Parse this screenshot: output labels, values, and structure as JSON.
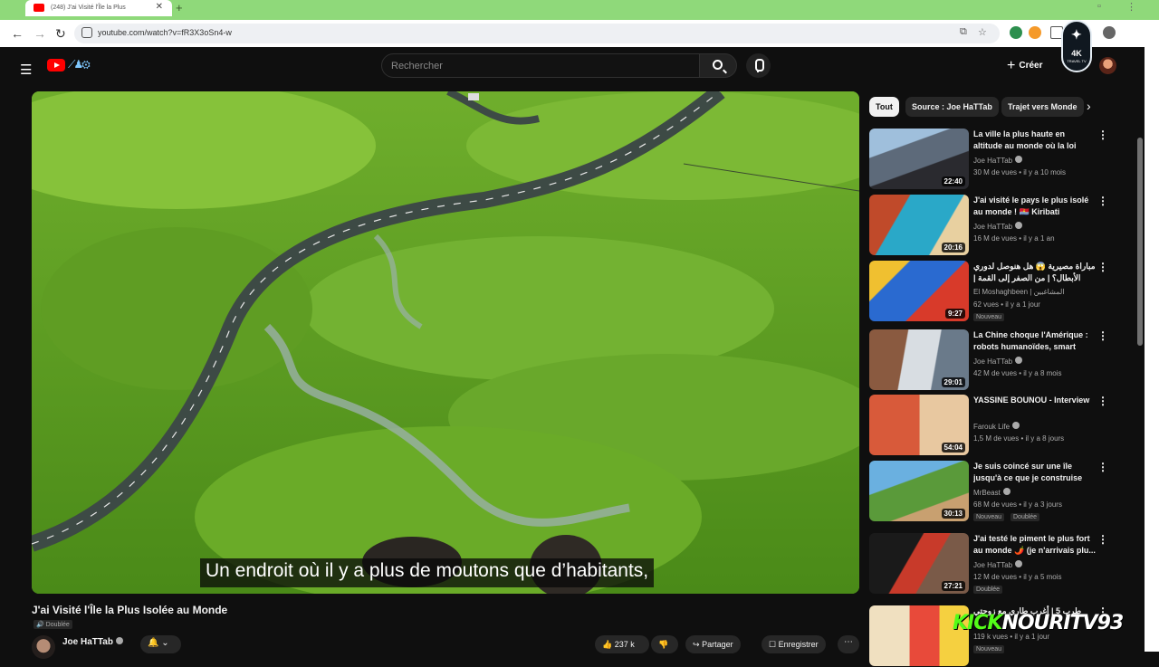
{
  "browser": {
    "tab_title": "(248) J'ai Visité l'Île la Plus",
    "url": "youtube.com/watch?v=fR3X3oSn4-w",
    "nav": {
      "back": "←",
      "forward": "→",
      "reload": "↻"
    }
  },
  "badge": {
    "label": "4K",
    "sub": "TRAVEL TV"
  },
  "youtube": {
    "search_placeholder": "Rechercher",
    "create_label": "Créer"
  },
  "video": {
    "subtitle": "Un endroit où il y a plus de moutons que d’habitants,",
    "title": "J'ai Visité l'Île la Plus Isolée au Monde",
    "dubbed": "Doublée",
    "channel": "Joe HaTTab",
    "likes": "237 k",
    "share_label": "Partager",
    "save_label": "Enregistrer"
  },
  "chips": [
    "Tout",
    "Source : Joe HaTTab",
    "Trajet vers Monde"
  ],
  "recommendations": [
    {
      "title": "La ville la plus haute en altitude au monde où la loi n'existe pas...",
      "channel": "Joe HaTTab",
      "meta": "30 M de vues • il y a 10 mois",
      "duration": "22:40",
      "badges": []
    },
    {
      "title": "J'ai visité le pays le plus isolé au monde ! 🇰🇮 Kiribati",
      "channel": "Joe HaTTab",
      "meta": "16 M de vues • il y a 1 an",
      "duration": "20:16",
      "badges": []
    },
    {
      "title": "مباراة مصيرية 😱 هل هنوصل لدوري الأبطال؟ | من الصفر إلى القمة | الحلقة",
      "channel": "El Moshaghbeen | المشاغبين",
      "meta": "62 vues • il y a 1 jour",
      "duration": "9:27",
      "badges": [
        "Nouveau"
      ]
    },
    {
      "title": "La Chine choque l'Amérique : robots humanoïdes, smart citi...",
      "channel": "Joe HaTTab",
      "meta": "42 M de vues • il y a 8 mois",
      "duration": "29:01",
      "badges": []
    },
    {
      "title": "YASSINE BOUNOU - Interview",
      "channel": "Farouk Life",
      "meta": "1,5 M de vues • il y a 8 jours",
      "duration": "54:04",
      "badges": []
    },
    {
      "title": "Je suis coincé sur une île jusqu'à ce que je construise un...",
      "channel": "MrBeast",
      "meta": "68 M de vues • il y a 3 jours",
      "duration": "30:13",
      "badges": [
        "Nouveau",
        "Doublée"
      ]
    },
    {
      "title": "J'ai testé le piment le plus fort au monde 🌶️ (je n'arrivais plu...",
      "channel": "Joe HaTTab",
      "meta": "12 M de vues • il y a 5 mois",
      "duration": "27:21",
      "badges": [
        "Doublée"
      ]
    },
    {
      "title": "طرب 5 | أغرب طاري مع زوجتي",
      "channel": "",
      "meta": "119 k vues • il y a 1 jour",
      "duration": "",
      "badges": [
        "Nouveau"
      ]
    }
  ],
  "overlay": {
    "kick": "KICK",
    "name": "NOURITV93"
  },
  "colors": {
    "accent_red": "#ff0000",
    "kick_green": "#53fc18",
    "bg": "#0f0f0f",
    "browser_green": "#8fd97a"
  }
}
